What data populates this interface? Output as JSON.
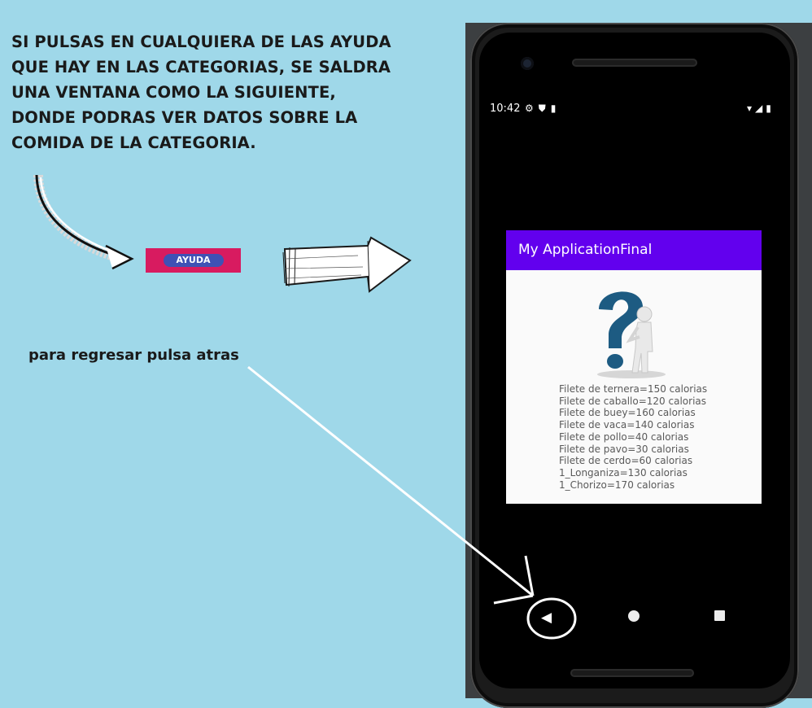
{
  "instructions": {
    "text": "SI PULSAS EN CUALQUIERA DE LAS AYUDA\nQUE HAY EN LAS CATEGORIAS, SE SALDRA\nUNA VENTANA COMO LA SIGUIENTE,\nDONDE PODRAS VER DATOS SOBRE LA\nCOMIDA DE LA CATEGORIA."
  },
  "ayuda_button": {
    "label": "AYUDA"
  },
  "back_hint": "para regresar pulsa atras",
  "phone": {
    "status_bar": {
      "time": "10:42"
    },
    "app": {
      "title": "My ApplicationFinal",
      "foods": [
        "Filete de ternera=150 calorias",
        "Filete de caballo=120 calorias",
        "Filete de buey=160 calorias",
        "Filete de vaca=140 calorias",
        "Filete de pollo=40 calorias",
        "Filete de pavo=30 calorias",
        "Filete de cerdo=60 calorias",
        "1_Longaniza=130 calorias",
        "1_Chorizo=170 calorias"
      ]
    }
  },
  "colors": {
    "background": "#9fd8e9",
    "app_bar": "#6200ee",
    "ayuda_strip": "#d81b60",
    "ayuda_button": "#3f51b5"
  }
}
